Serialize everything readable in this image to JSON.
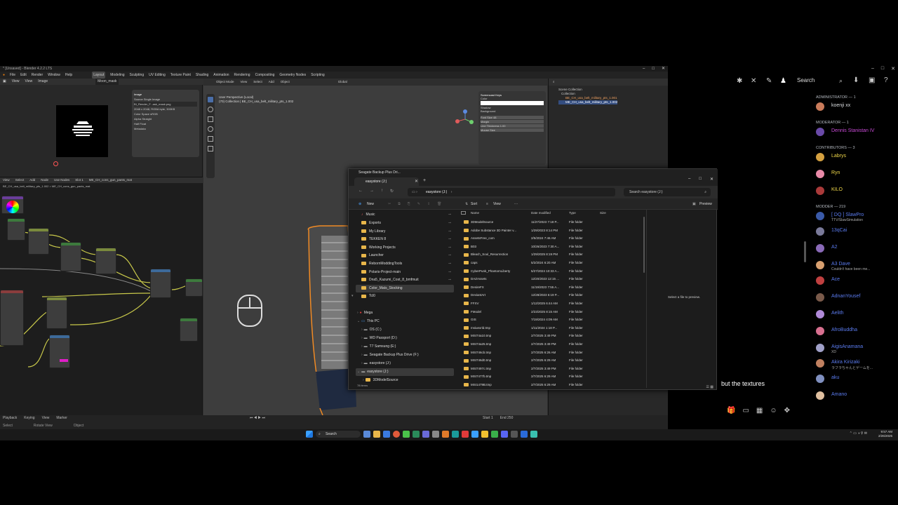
{
  "blender": {
    "title": "* [Unsaved] - Blender 4.2.2 LTS",
    "menus": [
      "File",
      "Edit",
      "Render",
      "Window",
      "Help"
    ],
    "workspaces": [
      "Layout",
      "Modeling",
      "Sculpting",
      "UV Editing",
      "Texture Paint",
      "Shading",
      "Animation",
      "Rendering",
      "Compositing",
      "Geometry Nodes",
      "Scripting"
    ],
    "image_editor": {
      "header": [
        "View",
        "View",
        "Image"
      ],
      "image_name": "Moon_mask",
      "panel_title": "Image",
      "panel_rows": [
        "Source   Single Image",
        "BI_Render_F...ask_mask.png",
        "2048 x 2048, RGBA byte, 300KB",
        "Color Space  sRGB",
        "Alpha  Straight",
        "Half Float",
        "Metadata"
      ]
    },
    "node_editor": {
      "header": [
        "View",
        "Select",
        "Add",
        "Node",
        "Use Nodes",
        "Slot 1",
        "ME_CH_cons_gun_pants_mat"
      ],
      "breadcrumb": "BE_CH_usa_belt_military_pts_1.002 > ME_CH_cons_gun_pants_mat"
    },
    "viewport": {
      "header": [
        "Object Mode",
        "View",
        "Select",
        "Add",
        "Object",
        "Global"
      ],
      "info_line1": "User Perspective (Local)",
      "info_line2": "(70) Collection | BE_CH_usa_belt_military_pts_1.002",
      "panel_rows": [
        "Screencast Keys",
        "Color",
        "Shadow",
        "Background",
        "Font Size   48",
        "Margin",
        "Line Thickness  1.00",
        "Mouse Size"
      ]
    },
    "outliner": {
      "header": "Scene Collection",
      "rows": [
        "Scene Collection",
        "Collection",
        "BE_CH_usa_belt_military_pts_1.001",
        "ME_CH_usa_belt_military_pts_1.002"
      ]
    },
    "timeline": {
      "header": [
        "Playback",
        "Keying",
        "View",
        "Marker"
      ],
      "status": [
        "Select",
        "Rotate View",
        "Object"
      ],
      "frame_start": "Start 1",
      "frame_end": "End 250"
    }
  },
  "explorer": {
    "window_title": "Seagate Backup Plus Dri...",
    "tab_label": "easystore (J:)",
    "path": "easystore (J:)",
    "search_placeholder": "Search easystore (J:)",
    "toolbar": {
      "new": "New",
      "sort": "Sort",
      "view": "View",
      "preview": "Preview"
    },
    "nav": [
      {
        "label": "Music"
      },
      {
        "label": "Exports"
      },
      {
        "label": "My Library"
      },
      {
        "label": "TEKKEN 8"
      },
      {
        "label": "Working Projects"
      },
      {
        "label": "Launcher"
      },
      {
        "label": "RebornModdingTools"
      },
      {
        "label": "Polaris-Project-main"
      },
      {
        "label": "Dna5_Kazumi_Cost_8_bmfmuit"
      },
      {
        "label": "Color_Mats_Stocking"
      },
      {
        "label": "Tcl0"
      },
      {
        "label": "Mega"
      },
      {
        "label": "This PC"
      },
      {
        "label": "OS (C:)"
      },
      {
        "label": "WD Passport (D:)"
      },
      {
        "label": "T7 Samsung (E:)"
      },
      {
        "label": "Seagate Backup Plus Drive (F:)"
      },
      {
        "label": "easystore (J:)"
      },
      {
        "label": "easystore (J:)"
      },
      {
        "label": "3DModelSource"
      }
    ],
    "columns": [
      "Name",
      "Date modified",
      "Type",
      "Size"
    ],
    "files": [
      {
        "name": "3DModelSource",
        "date": "11/27/2023 7:18 P...",
        "type": "File folder"
      },
      {
        "name": "Adobe Substance 3D Painter v...",
        "date": "1/29/2023 8:14 PM",
        "type": "File folder"
      },
      {
        "name": "AssetsFree_com",
        "date": "2/5/2024 7:46 AM",
        "type": "File folder"
      },
      {
        "name": "B03",
        "date": "10/26/2023 7:30 A...",
        "type": "File folder"
      },
      {
        "name": "Bleach_Soul_Resurrection",
        "date": "1/29/2025 8:19 PM",
        "type": "File folder"
      },
      {
        "name": "caps",
        "date": "5/2/2024 6:20 AM",
        "type": "File folder"
      },
      {
        "name": "CyberPunk_PhantomLiberty",
        "date": "5/27/2024 10:33 A...",
        "type": "File folder"
      },
      {
        "name": "DAZAssets",
        "date": "12/20/2023 12:15 ...",
        "type": "File folder"
      },
      {
        "name": "DesireFX",
        "date": "11/19/2023 7:55 A...",
        "type": "File folder"
      },
      {
        "name": "DeviantArt",
        "date": "12/28/2023 6:19 P...",
        "type": "File folder"
      },
      {
        "name": "FFXV",
        "date": "1/12/2025 6:44 AM",
        "type": "File folder"
      },
      {
        "name": "FModel",
        "date": "2/23/2025 8:15 AM",
        "type": "File folder"
      },
      {
        "name": "GIS",
        "date": "7/19/2024 4:09 AM",
        "type": "File folder"
      },
      {
        "name": "msiuexrld.tmp",
        "date": "1/11/2024 1:18 P...",
        "type": "File folder"
      },
      {
        "name": "MSI74a10.tmp",
        "date": "2/7/2025 3:49 PM",
        "type": "File folder"
      },
      {
        "name": "MSI74a25.tmp",
        "date": "2/7/2025 3:49 PM",
        "type": "File folder"
      },
      {
        "name": "MSI746cb.tmp",
        "date": "2/7/2025 6:26 AM",
        "type": "File folder"
      },
      {
        "name": "MSI746d0.tmp",
        "date": "2/7/2025 6:29 AM",
        "type": "File folder"
      },
      {
        "name": "MSI7497c.tmp",
        "date": "2/7/2025 3:49 PM",
        "type": "File folder"
      },
      {
        "name": "MSI7477b.tmp",
        "date": "2/7/2025 6:29 AM",
        "type": "File folder"
      },
      {
        "name": "MSI1479B.tmp",
        "date": "2/7/2025 6:29 AM",
        "type": "File folder"
      }
    ],
    "preview_text": "Select a file to preview.",
    "status": "78 items"
  },
  "discord": {
    "search_label": "Search",
    "sections": [
      {
        "header": "ADMINISTRATOR — 1",
        "members": [
          {
            "name": "koenji xx",
            "color": "#dbdee1"
          }
        ]
      },
      {
        "header": "MODERATOR — 1",
        "members": [
          {
            "name": "Dennis Stanistan IV",
            "color": "#c84bd6"
          }
        ]
      },
      {
        "header": "CONTRIBUTORS — 3",
        "members": [
          {
            "name": "Labrys",
            "color": "#f0d84a"
          },
          {
            "name": "Ryn",
            "color": "#f0d84a"
          },
          {
            "name": "KILO",
            "color": "#f0d84a"
          }
        ]
      },
      {
        "header": "MODDER — 219",
        "members": [
          {
            "name": "[ DQ ] SlawPro",
            "color": "#5b7cf0",
            "status": "TTV/SlawSimulation"
          },
          {
            "name": "13qCai",
            "color": "#5b7cf0"
          },
          {
            "name": "A2",
            "color": "#5b7cf0"
          },
          {
            "name": "A3 Dave",
            "color": "#5b7cf0",
            "status": "Couldn't have been me..."
          },
          {
            "name": "Ace",
            "color": "#5b7cf0"
          },
          {
            "name": "AdnanYousef",
            "color": "#5b7cf0"
          },
          {
            "name": "Aelith",
            "color": "#5b7cf0"
          },
          {
            "name": "AfroBuddha",
            "color": "#5b7cf0"
          },
          {
            "name": "AigisAnamana",
            "color": "#5b7cf0",
            "status": "XD"
          },
          {
            "name": "Akira Kirizaki",
            "color": "#5b7cf0",
            "status": "ラフラちゃんとゲームを..."
          },
          {
            "name": "aku",
            "color": "#5b7cf0"
          },
          {
            "name": "Amano",
            "color": "#5b7cf0"
          }
        ]
      }
    ],
    "caption": "but the textures"
  },
  "taskbar": {
    "search_label": "Search",
    "time": "9:57 AM",
    "date": "2/26/2025"
  }
}
